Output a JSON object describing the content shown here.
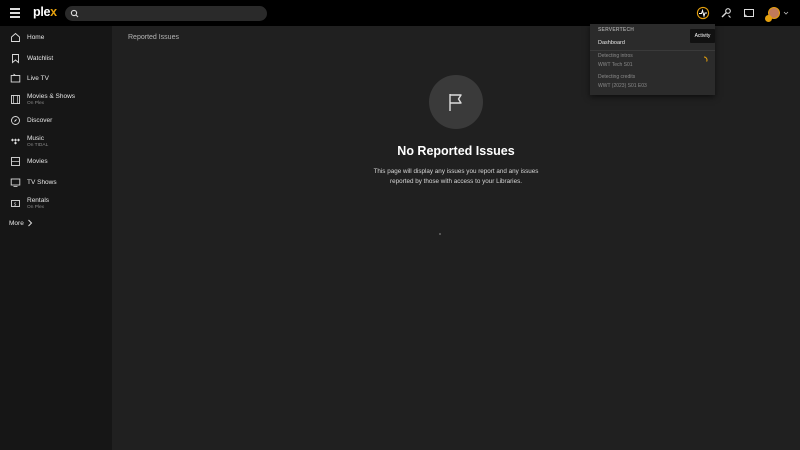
{
  "app": {
    "logo_main": "ple",
    "logo_accent": "x"
  },
  "search": {
    "placeholder": ""
  },
  "colors": {
    "accent": "#e5a00d",
    "background": "#1f1f1f",
    "sidebar": "#161616",
    "topbar": "#000000"
  },
  "sidebar": {
    "items": [
      {
        "label": "Home",
        "sub": "",
        "icon": "home-icon"
      },
      {
        "label": "Watchlist",
        "sub": "",
        "icon": "bookmark-icon"
      },
      {
        "label": "Live TV",
        "sub": "",
        "icon": "tv-icon"
      },
      {
        "label": "Movies & Shows",
        "sub": "On Plex",
        "icon": "film-icon"
      },
      {
        "label": "Discover",
        "sub": "",
        "icon": "compass-icon"
      },
      {
        "label": "Music",
        "sub": "On TIDAL",
        "icon": "music-icon"
      },
      {
        "label": "Movies",
        "sub": "",
        "icon": "film-icon"
      },
      {
        "label": "TV Shows",
        "sub": "",
        "icon": "tv-icon"
      },
      {
        "label": "Rentals",
        "sub": "On Plex",
        "icon": "ticket-icon"
      }
    ],
    "more_label": "More"
  },
  "main": {
    "breadcrumb": "Reported Issues",
    "empty_title": "No Reported Issues",
    "empty_desc_line1": "This page will display any issues you report and any issues",
    "empty_desc_line2": "reported by those with access to your Libraries."
  },
  "activity": {
    "tooltip": "Activity",
    "server_name": "SERVERTECH",
    "dashboard_label": "Dashboard",
    "tasks": [
      {
        "title": "Detecting intros",
        "sub": "WWT Tech S01"
      },
      {
        "title": "Detecting credits",
        "sub": "WWT (2023) S01 E03"
      }
    ]
  }
}
